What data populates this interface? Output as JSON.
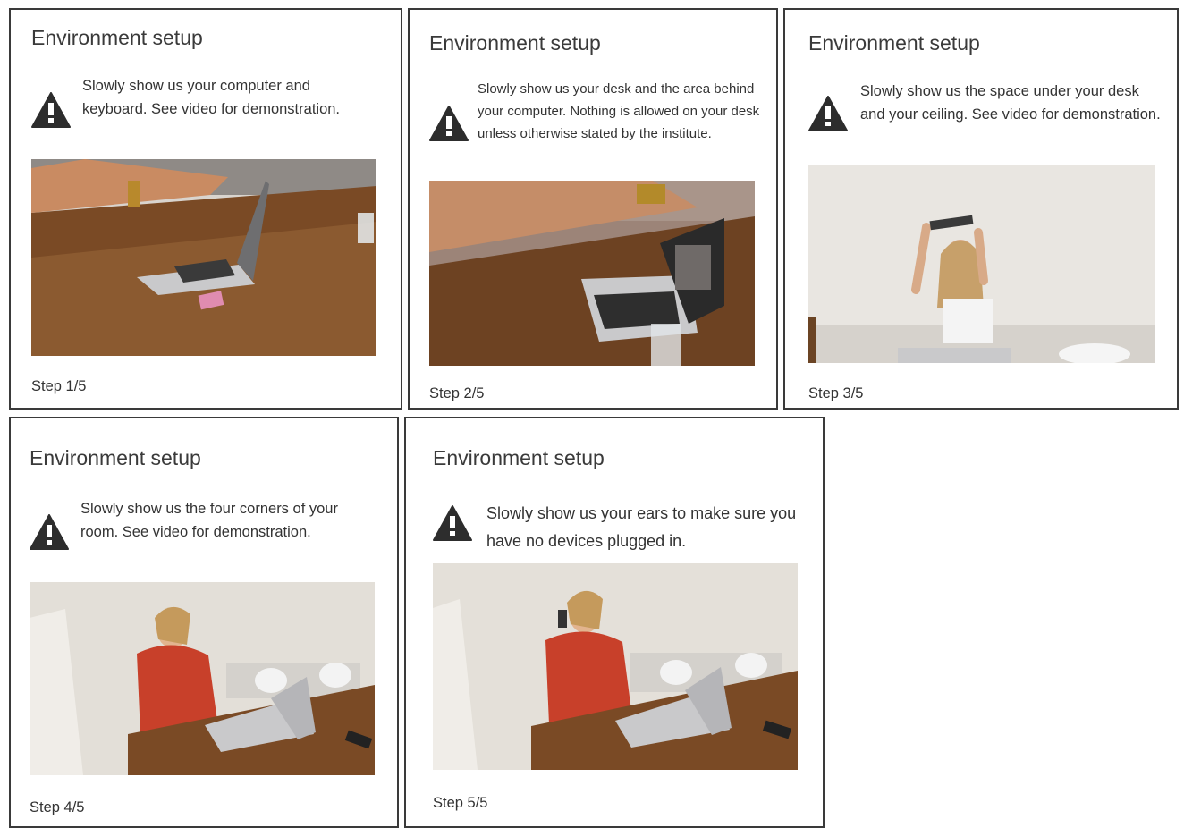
{
  "cards": [
    {
      "title": "Environment setup",
      "instruction": "Slowly show us your computer and keyboard. See video for demonstration.",
      "photo_alt": "Person showing a laptop keyboard on a wooden desk",
      "step": "Step 1/5"
    },
    {
      "title": "Environment setup",
      "instruction": "Slowly show us your desk and the area behind your computer. Nothing is allowed on your desk unless otherwise stated by the institute.",
      "photo_alt": "Hand sweeping across desk behind an open laptop",
      "step": "Step 2/5"
    },
    {
      "title": "Environment setup",
      "instruction": "Slowly show us the space under your desk and your ceiling. See video for demonstration.",
      "photo_alt": "Woman holding laptop above her head to show the ceiling",
      "step": "Step 3/5"
    },
    {
      "title": "Environment setup",
      "instruction": "Slowly show us the four corners of your room. See video for demonstration.",
      "photo_alt": "Woman in red sweater seated at desk with laptop",
      "step": "Step 4/5"
    },
    {
      "title": "Environment setup",
      "instruction": "Slowly show us your ears to make sure you have no devices plugged in.",
      "photo_alt": "Woman in red sweater showing her ear at desk with laptop",
      "step": "Step 5/5"
    }
  ],
  "colors": {
    "border": "#3a3a3a",
    "text": "#333333",
    "icon": "#2d2d2d",
    "wood": "#7a4a25",
    "wall": "#e9e6e1",
    "sweater": "#c8402a",
    "laptop": "#c9c9cb"
  },
  "icons": {
    "warning": "warning-triangle-icon"
  }
}
